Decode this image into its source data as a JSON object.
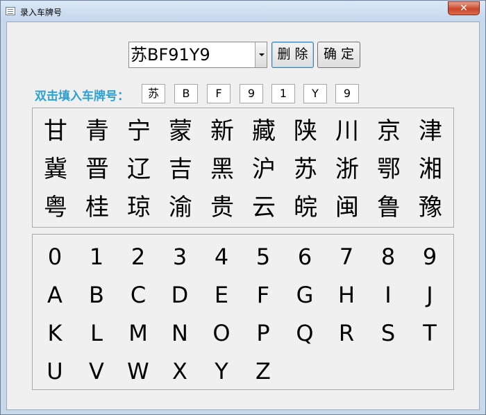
{
  "window": {
    "title": "录入车牌号",
    "close_label": "✕"
  },
  "toolbar": {
    "plate_value": "苏BF91Y9",
    "delete_label": "删 除",
    "confirm_label": "确 定"
  },
  "hint": {
    "label": "双击填入车牌号：",
    "chars": [
      "苏",
      "B",
      "F",
      "9",
      "1",
      "Y",
      "9"
    ]
  },
  "provinces": [
    "甘",
    "青",
    "宁",
    "蒙",
    "新",
    "藏",
    "陕",
    "川",
    "京",
    "津",
    "冀",
    "晋",
    "辽",
    "吉",
    "黑",
    "沪",
    "苏",
    "浙",
    "鄂",
    "湘",
    "粤",
    "桂",
    "琼",
    "渝",
    "贵",
    "云",
    "皖",
    "闽",
    "鲁",
    "豫"
  ],
  "alnum": [
    "0",
    "1",
    "2",
    "3",
    "4",
    "5",
    "6",
    "7",
    "8",
    "9",
    "A",
    "B",
    "C",
    "D",
    "E",
    "F",
    "G",
    "H",
    "I",
    "J",
    "K",
    "L",
    "M",
    "N",
    "O",
    "P",
    "Q",
    "R",
    "S",
    "T",
    "U",
    "V",
    "W",
    "X",
    "Y",
    "Z"
  ],
  "icons": {
    "app": "form-icon",
    "dropdown": "chevron-down-icon"
  },
  "colors": {
    "hint": "#2ba1d6",
    "close_button": "#c9462a"
  }
}
